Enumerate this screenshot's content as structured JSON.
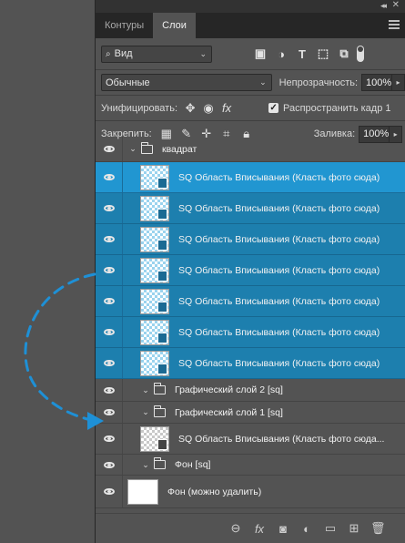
{
  "panel": {
    "collapse_icon": "double-chevron-right-icon",
    "close_icon": "close-icon",
    "tabs": [
      {
        "label": "Контуры",
        "active": false
      },
      {
        "label": "Слои",
        "active": true
      }
    ],
    "menu_icon": "hamburger-menu-icon"
  },
  "filter": {
    "kind_label": "Вид",
    "icons": [
      "image-filter-icon",
      "adjustment-filter-icon",
      "type-filter-icon",
      "shape-filter-icon",
      "smart-object-filter-icon"
    ]
  },
  "blend": {
    "mode": "Обычные",
    "opacity_label": "Непрозрачность:",
    "opacity_value": "100%"
  },
  "unify": {
    "label": "Унифицировать:",
    "propagate_label": "Распространить кадр 1",
    "propagate_checked": true
  },
  "lock": {
    "label": "Закрепить:",
    "fill_label": "Заливка:",
    "fill_value": "100%"
  },
  "layers": [
    {
      "type": "group",
      "name": "квадрат",
      "level": 0
    },
    {
      "type": "layer",
      "name": "SQ Область Вписывания (Класть фото сюда)",
      "state": "selected-primary"
    },
    {
      "type": "layer",
      "name": "SQ Область Вписывания (Класть фото сюда)",
      "state": "selected"
    },
    {
      "type": "layer",
      "name": "SQ Область Вписывания (Класть фото сюда)",
      "state": "selected"
    },
    {
      "type": "layer",
      "name": "SQ Область Вписывания (Класть фото сюда)",
      "state": "selected"
    },
    {
      "type": "layer",
      "name": "SQ Область Вписывания (Класть фото сюда)",
      "state": "selected"
    },
    {
      "type": "layer",
      "name": "SQ Область Вписывания (Класть фото сюда)",
      "state": "selected"
    },
    {
      "type": "layer",
      "name": "SQ Область Вписывания (Класть фото сюда)",
      "state": "selected"
    },
    {
      "type": "group",
      "name": "Графический слой 2 [sq]",
      "level": 1
    },
    {
      "type": "group",
      "name": "Графический слой 1 [sq]",
      "level": 1
    },
    {
      "type": "layer",
      "name": "SQ Область Вписывания (Класть фото сюда...",
      "state": "normal"
    },
    {
      "type": "group",
      "name": "Фон [sq]",
      "level": 1
    },
    {
      "type": "background",
      "name": "Фон (можно удалить)"
    }
  ],
  "footer_icons": [
    "link-layers-icon",
    "fx-icon",
    "mask-icon",
    "adjustment-layer-icon",
    "new-group-icon",
    "new-layer-icon",
    "trash-icon"
  ],
  "colors": {
    "selected_primary": "#2196d1",
    "selected": "#1d7fae",
    "arrow": "#1e90d6"
  }
}
